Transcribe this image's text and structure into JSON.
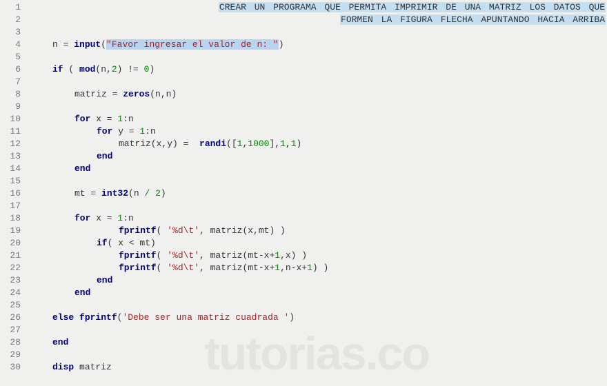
{
  "watermark": "tutorias.co",
  "lines": {
    "count": 30
  },
  "comment": {
    "l1_words": [
      "CREAR",
      "UN",
      "PROGRAMA",
      "QUE",
      "PERMITA",
      "IMPRIMIR",
      "DE",
      "UNA",
      "MATRIZ",
      "LOS",
      "DATOS",
      "QUE"
    ],
    "l2_words": [
      "FORMEN",
      "LA",
      "FIGURA",
      "FLECHA",
      "APUNTANDO",
      "HACIA",
      "ARRIBA"
    ]
  },
  "code": {
    "l4": {
      "var": "n = ",
      "fn": "input",
      "str": "\"Favor ingresar el valor de n: \""
    },
    "l6": {
      "kw": "if",
      "open": " ( ",
      "fn": "mod",
      "args": "(n,",
      "num": "2",
      "close": ") != ",
      "zero": "0",
      "end": ")"
    },
    "l8": {
      "var": "matriz = ",
      "fn": "zeros",
      "args": "(n,n)"
    },
    "l10": {
      "kw": "for",
      "txt": " x = ",
      "one": "1",
      "col": ":n"
    },
    "l11": {
      "kw": "for",
      "txt": " y = ",
      "one": "1",
      "col": ":n"
    },
    "l12": {
      "txt": "matriz(x,y) =  ",
      "fn": "randi",
      "open": "([",
      "a": "1",
      "c": ",",
      "b": "1000",
      "close": "],",
      "d": "1",
      "c2": ",",
      "e": "1",
      "end": ")"
    },
    "l13": {
      "kw": "end"
    },
    "l14": {
      "kw": "end"
    },
    "l16": {
      "var": "mt = ",
      "fn": "int32",
      "open": "(n ",
      "op": "/",
      "sp": " ",
      "num": "2",
      "close": ")"
    },
    "l18": {
      "kw": "for",
      "txt": " x = ",
      "one": "1",
      "col": ":n"
    },
    "l19": {
      "fn": "fprintf",
      "open": "( ",
      "str": "'%d\\t'",
      "close": ", matriz(x,mt) )"
    },
    "l20": {
      "kw": "if",
      "txt": "( x < mt)"
    },
    "l21": {
      "fn": "fprintf",
      "open": "( ",
      "str": "'%d\\t'",
      "close": ", matriz(mt-x+",
      "one": "1",
      "c": ",x) )"
    },
    "l22": {
      "fn": "fprintf",
      "open": "( ",
      "str": "'%d\\t'",
      "close": ", matriz(mt-x+",
      "one": "1",
      "c": ",n-x+",
      "one2": "1",
      "end": ") )"
    },
    "l23": {
      "kw": "end"
    },
    "l24": {
      "kw": "end"
    },
    "l26": {
      "kw": "else",
      "sp": " ",
      "fn": "fprintf",
      "open": "(",
      "str": "'Debe ser una matriz cuadrada '",
      "close": ")"
    },
    "l28": {
      "kw": "end"
    },
    "l30": {
      "kw": "disp",
      "txt": " matriz"
    }
  }
}
